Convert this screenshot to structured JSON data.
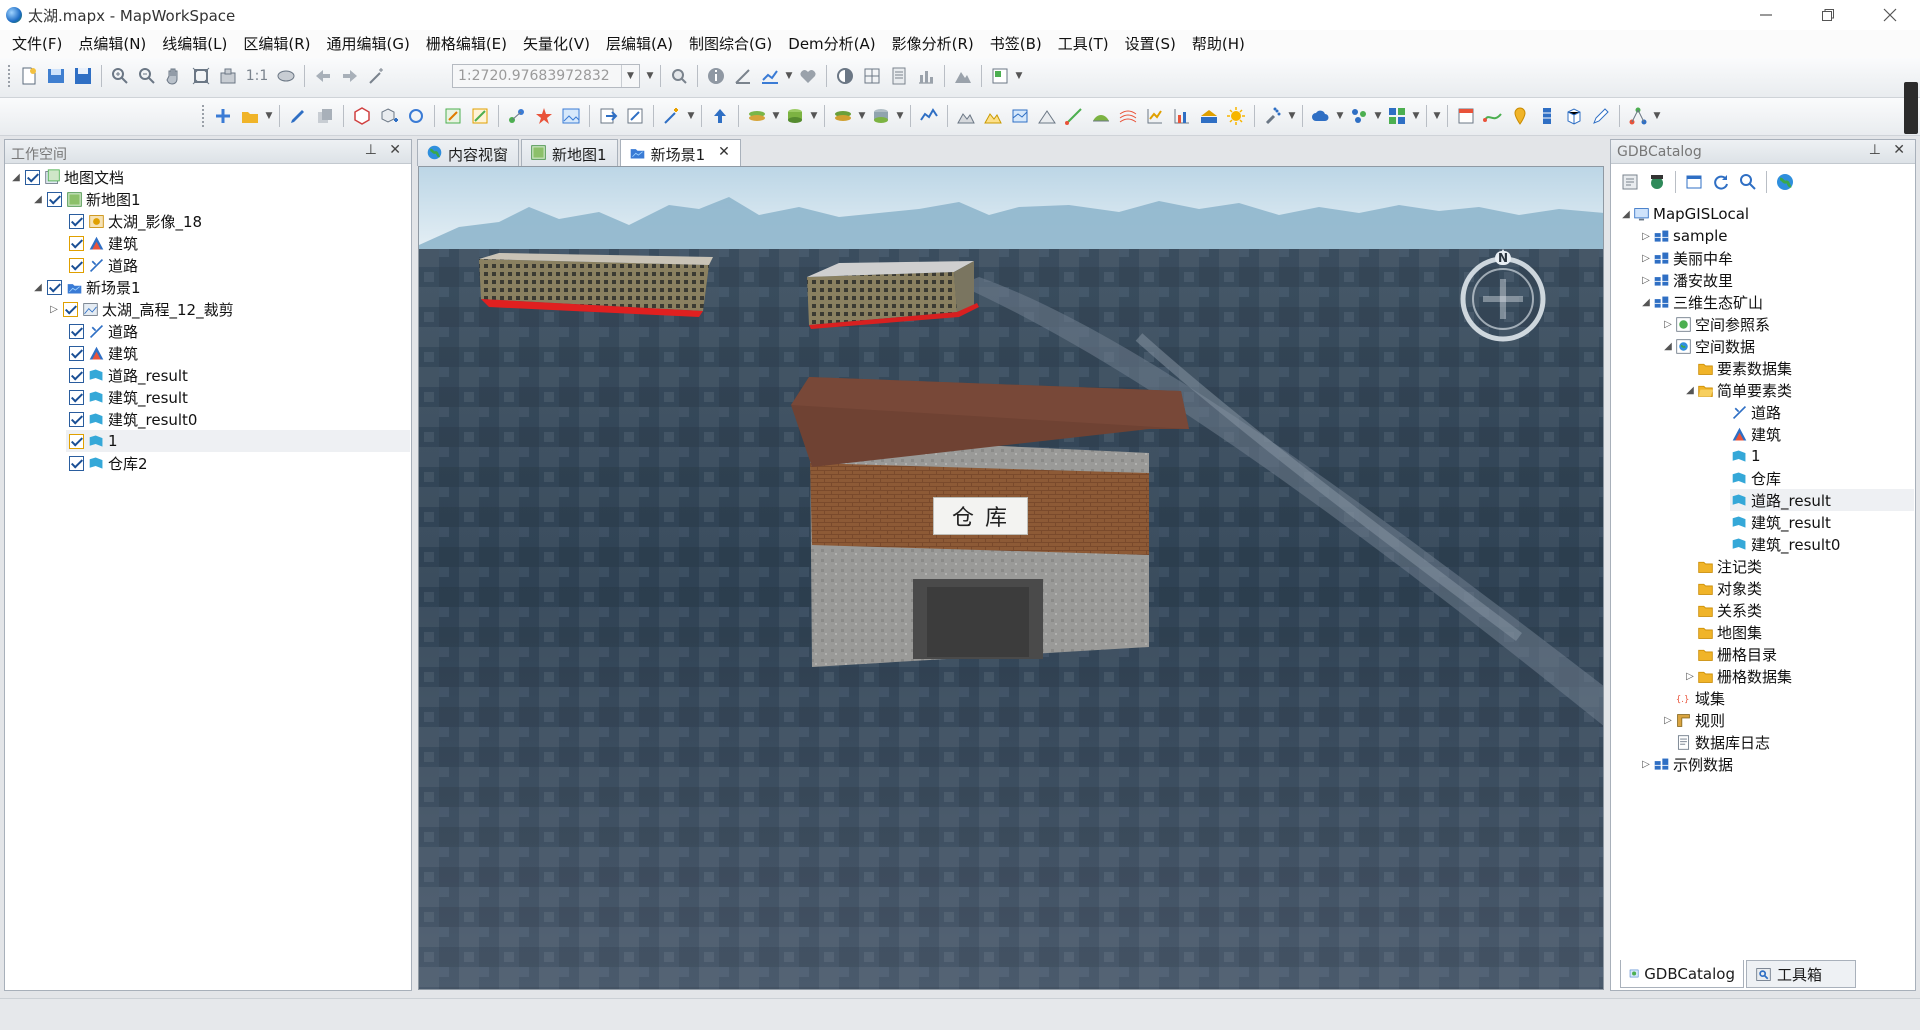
{
  "window": {
    "title": "太湖.mapx - MapWorkSpace",
    "controls": [
      "minimize",
      "restore",
      "close"
    ]
  },
  "menu": [
    "文件(F)",
    "点编辑(N)",
    "线编辑(L)",
    "区编辑(R)",
    "通用编辑(G)",
    "栅格编辑(E)",
    "矢量化(V)",
    "层编辑(A)",
    "制图综合(G)",
    "Dem分析(A)",
    "影像分析(R)",
    "书签(B)",
    "工具(T)",
    "设置(S)",
    "帮助(H)"
  ],
  "toolbar": {
    "scale_value": "1:2720.97683972832",
    "ratio_label": "1:1"
  },
  "workspace": {
    "title": "工作空间",
    "root": "地图文档",
    "map": "新地图1",
    "map_layers": [
      "太湖_影像_18",
      "建筑",
      "道路"
    ],
    "scene": "新场景1",
    "scene_layers": [
      "太湖_高程_12_裁剪",
      "道路",
      "建筑",
      "道路_result",
      "建筑_result",
      "建筑_result0",
      "1",
      "仓库2"
    ]
  },
  "tabs": [
    "内容视窗",
    "新地图1",
    "新场景1"
  ],
  "active_tab": "新场景1",
  "scene": {
    "building_sign": "仓 库",
    "compass_label": "N"
  },
  "catalog": {
    "title": "GDBCatalog",
    "root": "MapGISLocal",
    "databases": [
      "sample",
      "美丽中牟",
      "潘安故里",
      "三维生态矿山"
    ],
    "db_children": [
      "空间参照系",
      "空间数据"
    ],
    "spatial_children": [
      "要素数据集",
      "简单要素类"
    ],
    "feature_classes": [
      "道路",
      "建筑",
      "1",
      "仓库",
      "道路_result",
      "建筑_result",
      "建筑_result0"
    ],
    "other_folders": [
      "注记类",
      "对象类",
      "关系类",
      "地图集",
      "栅格目录",
      "栅格数据集"
    ],
    "extras": [
      "域集",
      "规则",
      "数据库日志"
    ],
    "last_db": "示例数据",
    "bottom_tabs": [
      "GDBCatalog",
      "工具箱"
    ]
  },
  "colors": {
    "accent": "#2a6ebb",
    "check": "#1a4f95",
    "folder": "#f0b429",
    "selection": "#eef0f3"
  }
}
